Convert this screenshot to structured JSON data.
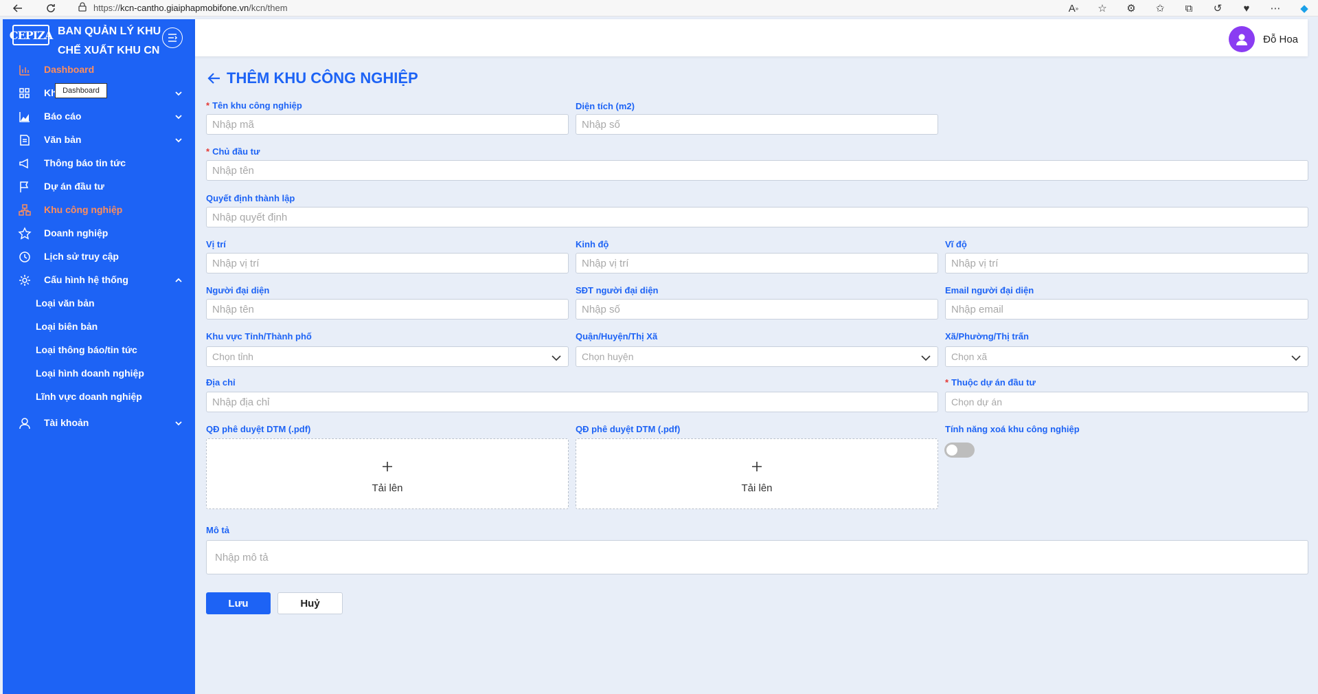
{
  "browser": {
    "url_prefix": "https://",
    "url_host": "kcn-cantho.giaiphapmobifone.vn",
    "url_path": "/kcn/them"
  },
  "sidebar": {
    "logo_text": "CEPIZA",
    "org_name": "BAN QUẢN LÝ KHU CHẾ XUẤT KHU CN",
    "tooltip": "Dashboard",
    "items": [
      {
        "label": "Dashboard",
        "icon": "bar-chart-icon",
        "active": true
      },
      {
        "label": "Kh",
        "icon": "grid-icon",
        "chevron": "down"
      },
      {
        "label": "Báo cáo",
        "icon": "area-chart-icon",
        "chevron": "down"
      },
      {
        "label": "Văn bản",
        "icon": "document-icon",
        "chevron": "down"
      },
      {
        "label": "Thông báo tin tức",
        "icon": "megaphone-icon"
      },
      {
        "label": "Dự án đầu tư",
        "icon": "flag-icon"
      },
      {
        "label": "Khu công nghiệp",
        "icon": "factory-icon",
        "active": true
      },
      {
        "label": "Doanh nghiệp",
        "icon": "star-icon"
      },
      {
        "label": "Lịch sử truy cập",
        "icon": "history-icon"
      },
      {
        "label": "Cấu hình hệ thống",
        "icon": "gear-icon",
        "chevron": "up"
      }
    ],
    "sub_items": [
      "Loại văn bản",
      "Loại biên bản",
      "Loại thông báo/tin tức",
      "Loại hình doanh nghiệp",
      "Lĩnh vực doanh nghiệp"
    ],
    "account": {
      "label": "Tài khoản",
      "icon": "user-icon",
      "chevron": "down"
    }
  },
  "header": {
    "user_name": "Đỗ Hoa"
  },
  "form": {
    "title": "THÊM KHU CÔNG NGHIỆP",
    "ten_kcn": {
      "label": "Tên khu công nghiệp",
      "placeholder": "Nhập mã",
      "required": true
    },
    "dien_tich": {
      "label": "Diện tích (m2)",
      "placeholder": "Nhập số"
    },
    "chu_dau_tu": {
      "label": "Chủ đầu tư",
      "placeholder": "Nhập tên",
      "required": true
    },
    "quyet_dinh": {
      "label": "Quyết định thành lập",
      "placeholder": "Nhập quyết định"
    },
    "vi_tri": {
      "label": "Vị trí",
      "placeholder": "Nhập vị trí"
    },
    "kinh_do": {
      "label": "Kinh độ",
      "placeholder": "Nhập vị trí"
    },
    "vi_do": {
      "label": "Vĩ độ",
      "placeholder": "Nhập vị trí"
    },
    "nguoi_dai_dien": {
      "label": "Người đại diện",
      "placeholder": "Nhập tên"
    },
    "sdt": {
      "label": "SĐT người đại diện",
      "placeholder": "Nhập số"
    },
    "email": {
      "label": "Email người đại diện",
      "placeholder": "Nhập email"
    },
    "tinh": {
      "label": "Khu vực Tỉnh/Thành phố",
      "placeholder": "Chọn tỉnh"
    },
    "huyen": {
      "label": "Quận/Huyện/Thị Xã",
      "placeholder": "Chọn huyện"
    },
    "xa": {
      "label": "Xã/Phường/Thị trấn",
      "placeholder": "Chọn xã"
    },
    "dia_chi": {
      "label": "Địa chỉ",
      "placeholder": "Nhập địa chỉ"
    },
    "du_an": {
      "label": "Thuộc dự án đầu tư",
      "placeholder": "Chọn dự án",
      "required": true
    },
    "qd_dtm_1": {
      "label": "QĐ phê duyệt DTM (.pdf)",
      "upload_label": "Tải lên"
    },
    "qd_dtm_2": {
      "label": "QĐ phê duyệt DTM (.pdf)",
      "upload_label": "Tải lên"
    },
    "xoa_toggle": {
      "label": "Tính năng xoá khu công nghiệp",
      "on": false
    },
    "mo_ta": {
      "label": "Mô tả",
      "placeholder": "Nhập mô tả"
    },
    "save_label": "Lưu",
    "cancel_label": "Huỷ"
  }
}
